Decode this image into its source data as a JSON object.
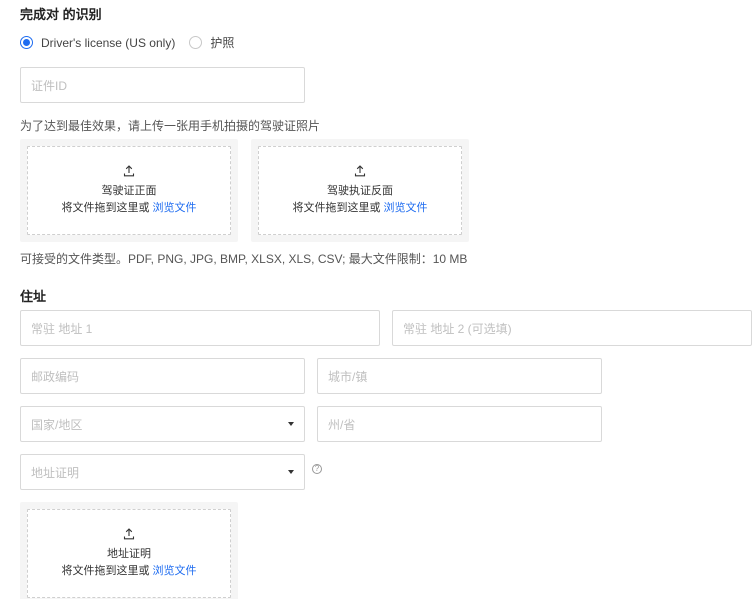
{
  "page": {
    "title": "完成对 的识别",
    "id_type_options": [
      {
        "label": "Driver's license (US only)",
        "selected": true
      },
      {
        "label": "护照",
        "selected": false
      }
    ],
    "id_field": {
      "placeholder": "证件ID"
    },
    "photo_hint": "为了达到最佳效果，请上传一张用手机拍摄的驾驶证照片",
    "uploads": {
      "front": {
        "title": "驾驶证正面",
        "drag_text": "将文件拖到这里或",
        "browse_text": "浏览文件"
      },
      "back": {
        "title": "驾驶执证反面",
        "drag_text": "将文件拖到这里或",
        "browse_text": "浏览文件"
      },
      "address_proof": {
        "title": "地址证明",
        "drag_text": "将文件拖到这里或",
        "browse_text": "浏览文件"
      }
    },
    "file_types_hint": "可接受的文件类型。PDF, PNG, JPG, BMP, XLSX, XLS, CSV; 最大文件限制：10 MB"
  },
  "address": {
    "section_title": "住址",
    "line1": {
      "placeholder": "常驻 地址 1"
    },
    "line2": {
      "placeholder": "常驻 地址 2 (可选填)"
    },
    "postal_code": {
      "placeholder": "邮政编码"
    },
    "city": {
      "placeholder": "城市/镇"
    },
    "country": {
      "placeholder": "国家/地区"
    },
    "state": {
      "placeholder": "州/省"
    },
    "proof_select": {
      "placeholder": "地址证明"
    },
    "help_glyph": "?"
  },
  "colors": {
    "accent": "#1e6cf0",
    "border": "#d9d9d9",
    "placeholder": "#bfbfbf"
  }
}
